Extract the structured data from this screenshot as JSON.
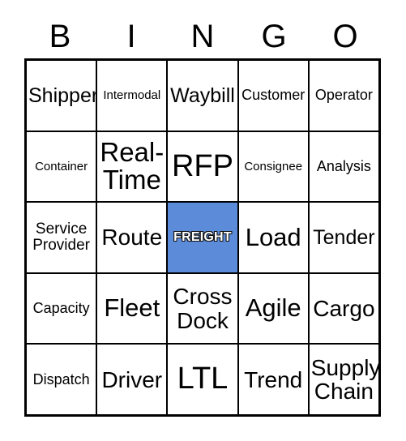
{
  "card": {
    "title": "BINGO",
    "header_letters": [
      "B",
      "I",
      "N",
      "G",
      "O"
    ],
    "marked_color": "#5b8bd9",
    "border_color": "#000000",
    "background_color": "#ffffff",
    "cells": [
      {
        "label": "Shipper",
        "size": "fs-lg",
        "marked": false
      },
      {
        "label": "Intermodal",
        "size": "fs-xs",
        "marked": false
      },
      {
        "label": "Waybill",
        "size": "fs-lg",
        "marked": false
      },
      {
        "label": "Customer",
        "size": "fs-sm",
        "marked": false
      },
      {
        "label": "Operator",
        "size": "fs-sm",
        "marked": false
      },
      {
        "label": "Container",
        "size": "fs-xs",
        "marked": false
      },
      {
        "label": "Real-Time",
        "size": "fs-3xl",
        "marked": false
      },
      {
        "label": "RFP",
        "size": "fs-4xl",
        "marked": false
      },
      {
        "label": "Consignee",
        "size": "fs-xs",
        "marked": false
      },
      {
        "label": "Analysis",
        "size": "fs-sm",
        "marked": false
      },
      {
        "label": "Service Provider",
        "size": "fs-md",
        "marked": false
      },
      {
        "label": "Route",
        "size": "fs-xl",
        "marked": false
      },
      {
        "label": "FREIGHT",
        "size": "fs-sm",
        "marked": true
      },
      {
        "label": "Load",
        "size": "fs-2xl",
        "marked": false
      },
      {
        "label": "Tender",
        "size": "fs-lg",
        "marked": false
      },
      {
        "label": "Capacity",
        "size": "fs-sm",
        "marked": false
      },
      {
        "label": "Fleet",
        "size": "fs-2xl",
        "marked": false
      },
      {
        "label": "Cross Dock",
        "size": "fs-xl",
        "marked": false
      },
      {
        "label": "Agile",
        "size": "fs-2xl",
        "marked": false
      },
      {
        "label": "Cargo",
        "size": "fs-xl",
        "marked": false
      },
      {
        "label": "Dispatch",
        "size": "fs-sm",
        "marked": false
      },
      {
        "label": "Driver",
        "size": "fs-xl",
        "marked": false
      },
      {
        "label": "LTL",
        "size": "fs-4xl",
        "marked": false
      },
      {
        "label": "Trend",
        "size": "fs-xl",
        "marked": false
      },
      {
        "label": "Supply Chain",
        "size": "fs-xl",
        "marked": false
      }
    ]
  }
}
